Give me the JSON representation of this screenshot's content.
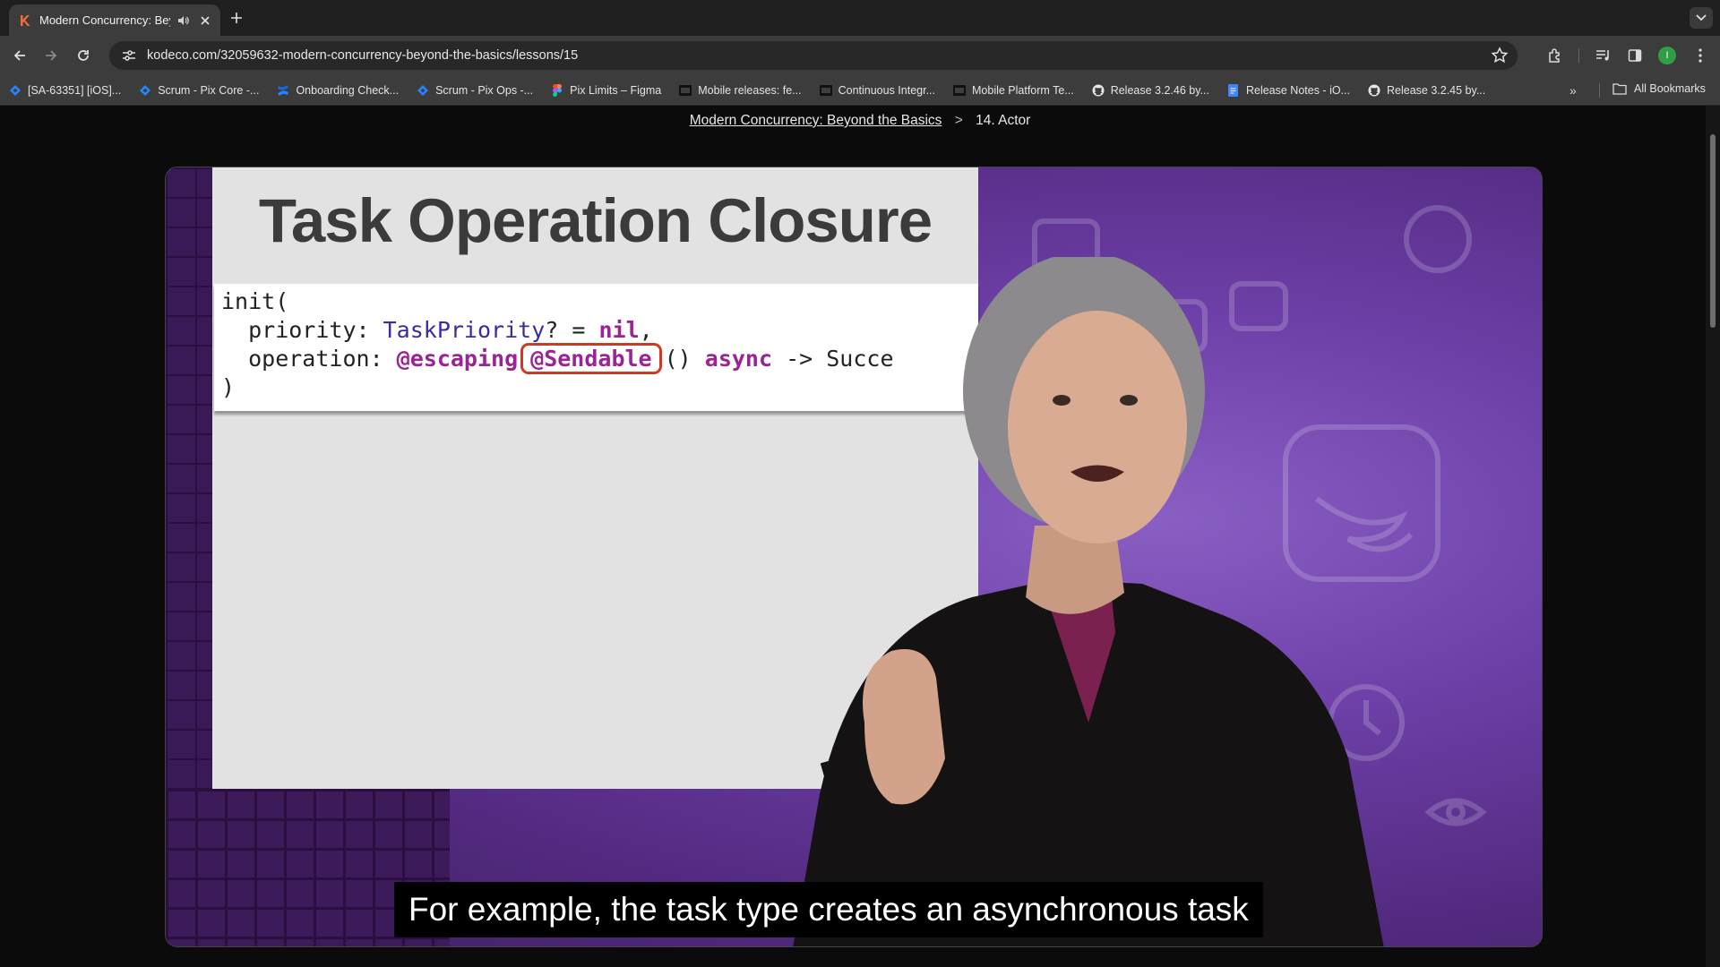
{
  "browser": {
    "tab": {
      "title": "Modern Concurrency: Bey",
      "favicon": "kodeco-k-icon"
    },
    "address": {
      "url": "kodeco.com/32059632-modern-concurrency-beyond-the-basics/lessons/15"
    },
    "profile_initial": "I",
    "bookmarks": [
      {
        "label": "[SA-63351] [iOS]...",
        "icon": "jira-icon"
      },
      {
        "label": "Scrum - Pix Core -...",
        "icon": "jira-icon"
      },
      {
        "label": "Onboarding Check...",
        "icon": "confluence-icon"
      },
      {
        "label": "Scrum - Pix Ops -...",
        "icon": "jira-icon"
      },
      {
        "label": "Pix Limits – Figma",
        "icon": "figma-icon"
      },
      {
        "label": "Mobile releases: fe...",
        "icon": "rwy-icon"
      },
      {
        "label": "Continuous Integr...",
        "icon": "rwy-icon"
      },
      {
        "label": "Mobile Platform Te...",
        "icon": "rwy-icon"
      },
      {
        "label": "Release 3.2.46 by...",
        "icon": "github-icon"
      },
      {
        "label": "Release Notes - iO...",
        "icon": "docs-icon"
      },
      {
        "label": "Release 3.2.45 by...",
        "icon": "github-icon"
      }
    ],
    "all_bookmarks": "All Bookmarks"
  },
  "breadcrumb": {
    "course": "Modern Concurrency: Beyond the Basics",
    "separator": ">",
    "lesson": "14. Actor"
  },
  "video": {
    "slide_title": "Task Operation Closure",
    "code": {
      "line1": "init(",
      "line2_prefix": "  priority: ",
      "line2_type": "TaskPriority",
      "line2_mid": "? = ",
      "line2_kw": "nil",
      "line2_end": ",",
      "line3_prefix": "  operation: ",
      "line3_kw1": "@escaping",
      "line3_highlight": "@Sendable",
      "line3_mid": "() ",
      "line3_kw2": "async",
      "line3_end": " -> Succe",
      "line4": ")"
    },
    "caption": "For example, the task type creates an asynchronous task"
  }
}
